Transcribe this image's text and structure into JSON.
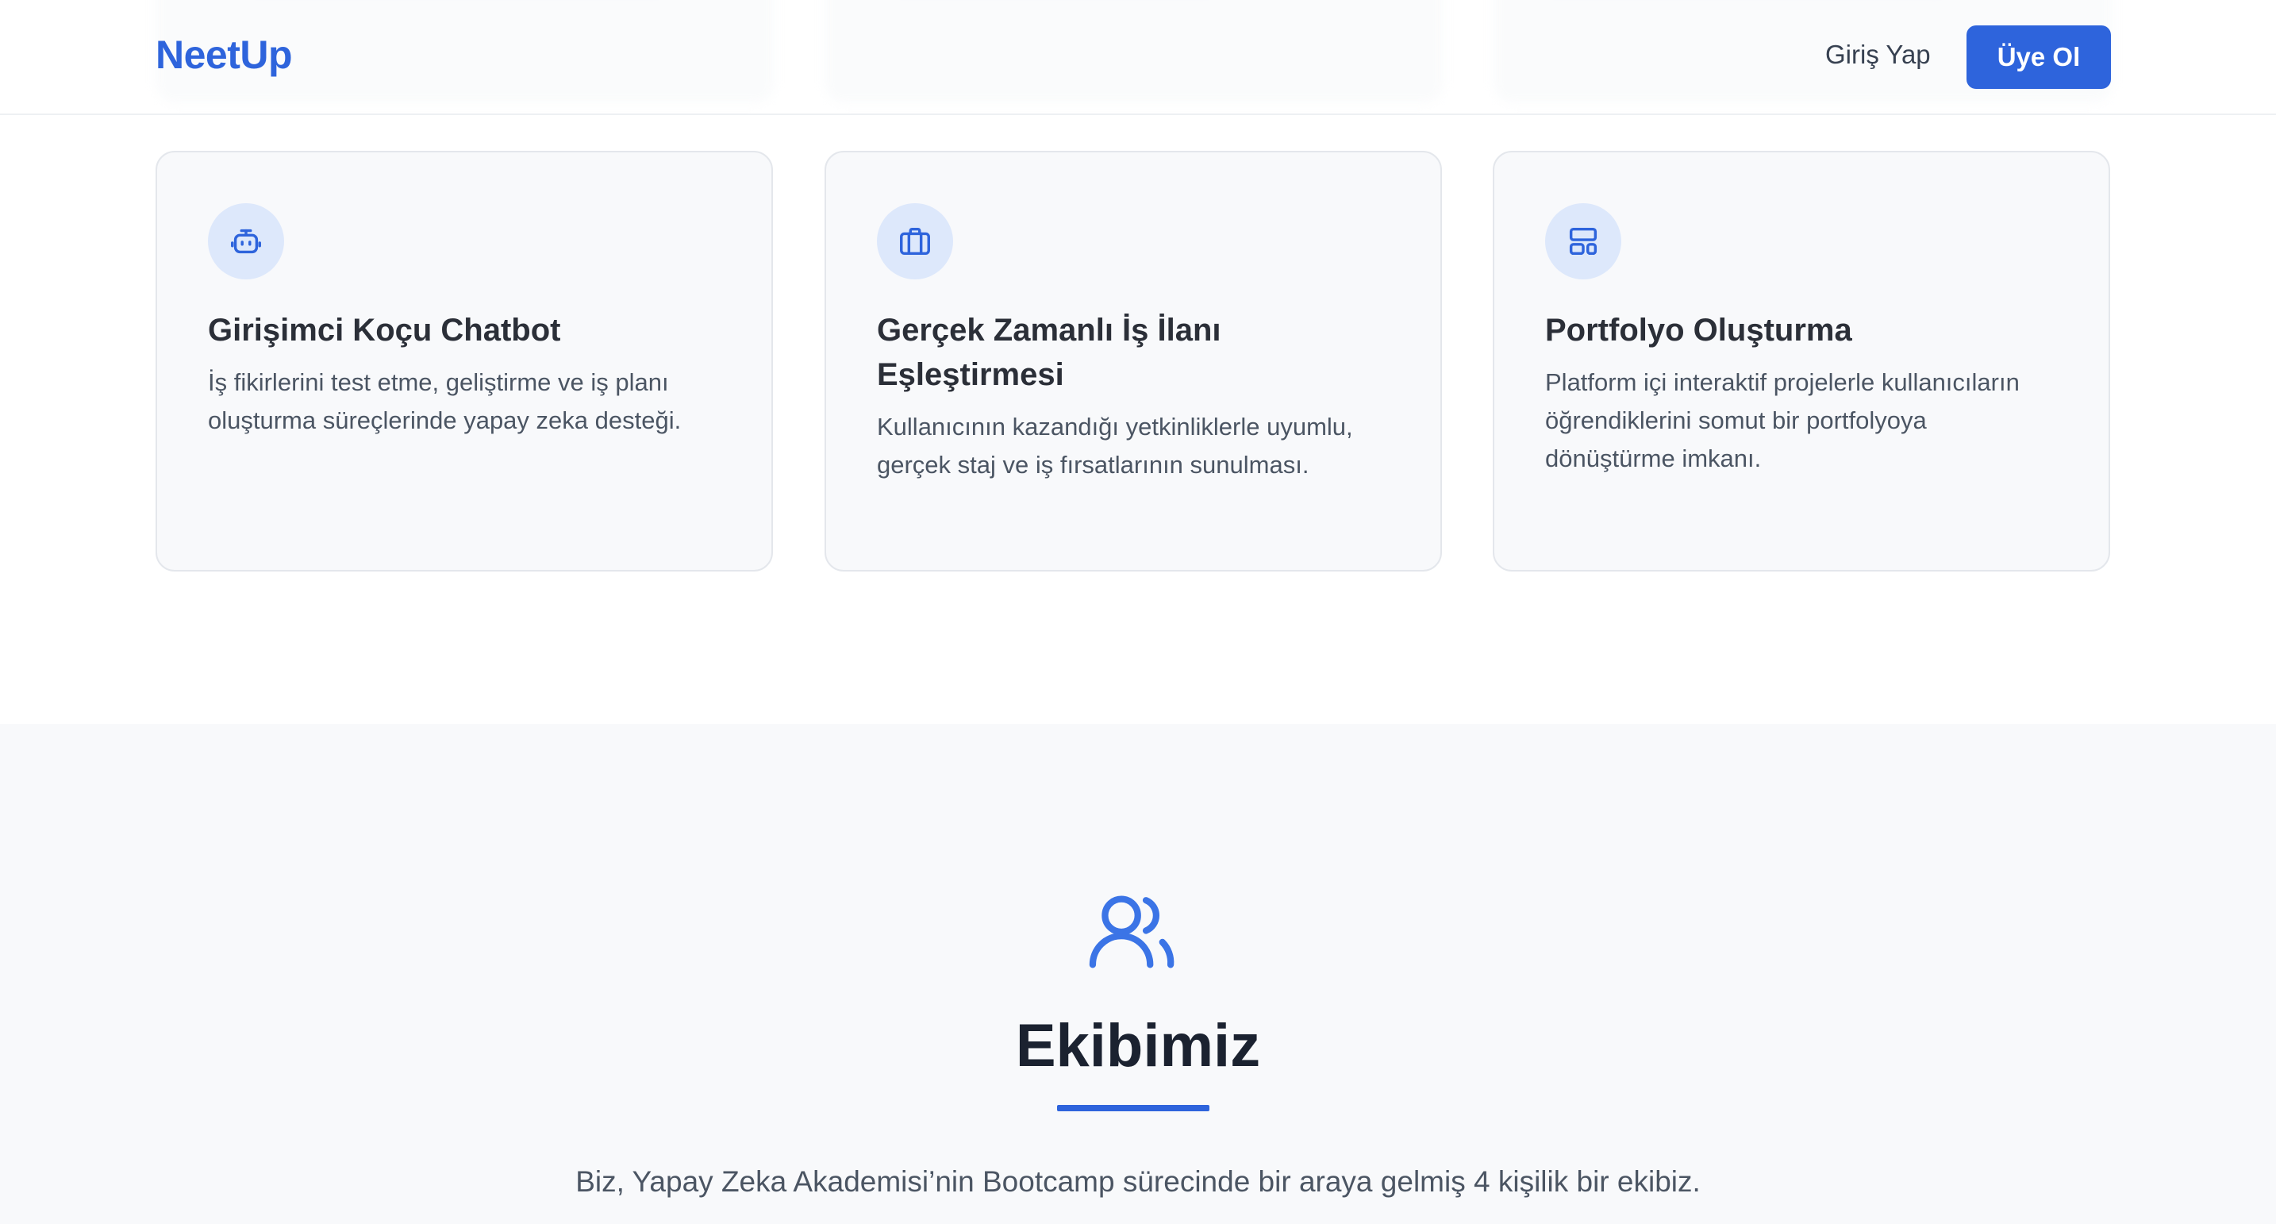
{
  "header": {
    "logo": "NeetUp",
    "login_label": "Giriş Yap",
    "signup_label": "Üye Ol"
  },
  "features": [
    {
      "icon": "robot-icon",
      "title": "Girişimci Koçu Chatbot",
      "description": "İş fikirlerini test etme, geliştirme ve iş planı oluşturma süreçlerinde yapay zeka desteği."
    },
    {
      "icon": "briefcase-icon",
      "title": "Gerçek Zamanlı İş İlanı Eşleştirmesi",
      "description": "Kullanıcının kazandığı yetkinliklerle uyumlu, gerçek staj ve iş fırsatlarının sunulması."
    },
    {
      "icon": "layout-icon",
      "title": "Portfolyo Oluşturma",
      "description": "Platform içi interaktif projelerle kullanıcıların öğrendiklerini somut bir portfolyoya dönüştürme imkanı."
    }
  ],
  "team": {
    "icon": "users-icon",
    "title": "Ekibimiz",
    "text": "Biz, Yapay Zeka Akademisi’nin Bootcamp sürecinde bir araya gelmiş 4 kişilik bir ekibiz."
  },
  "colors": {
    "primary": "#2e64dc",
    "icon_bg": "#dde8fb",
    "card_bg": "#f8f9fb",
    "section_bg": "#f8f9fb"
  }
}
